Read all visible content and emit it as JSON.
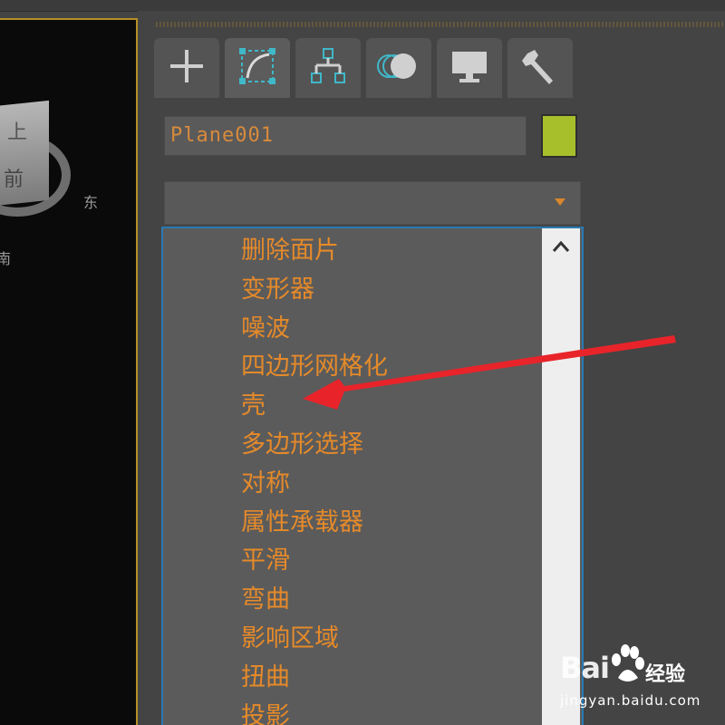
{
  "viewport": {
    "labels": [
      "上",
      "前",
      "东",
      "南"
    ]
  },
  "command_panel": {
    "tabs": [
      {
        "name": "create",
        "icon": "plus-icon"
      },
      {
        "name": "modify",
        "icon": "modify-curve-icon"
      },
      {
        "name": "hierarchy",
        "icon": "hierarchy-icon"
      },
      {
        "name": "motion",
        "icon": "motion-icon"
      },
      {
        "name": "display",
        "icon": "monitor-icon"
      },
      {
        "name": "utilities",
        "icon": "wrench-icon"
      }
    ],
    "active_tab": "modify",
    "object_name": "Plane001",
    "object_color": "#a8bf2c",
    "modifier_dropdown_value": "",
    "modifier_list": [
      "删除面片",
      "变形器",
      "噪波",
      "四边形网格化",
      "壳",
      "多边形选择",
      "对称",
      "属性承载器",
      "平滑",
      "弯曲",
      "影响区域",
      "扭曲",
      "投影"
    ],
    "highlighted_item": "壳",
    "accent_color": "#e58a2a",
    "list_border_color": "#2a79b4"
  },
  "annotation": {
    "type": "red-arrow",
    "points_to": "壳",
    "color": "#e8242a"
  },
  "watermark": {
    "brand": "Bai",
    "brand_suffix": "经验",
    "url": "jingyan.baidu.com"
  }
}
